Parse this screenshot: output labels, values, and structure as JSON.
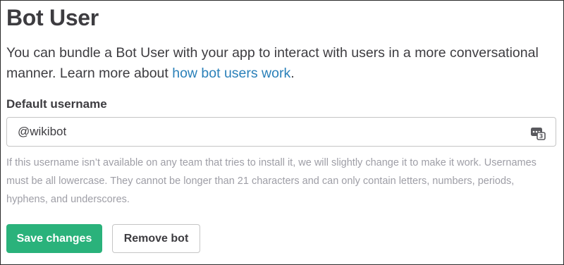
{
  "section": {
    "title": "Bot User",
    "description_before_link": "You can bundle a Bot User with your app to interact with users in a more conversational manner. Learn more about ",
    "description_link": "how bot users work",
    "description_after_link": "."
  },
  "username_field": {
    "label": "Default username",
    "value": "@wikibot",
    "icon": "password-manager-icon",
    "help_text": "If this username isn’t available on any team that tries to install it, we will slightly change it to make it work. Usernames must be all lowercase. They cannot be longer than 21 characters and can only contain letters, numbers, periods, hyphens, and underscores."
  },
  "actions": {
    "save_label": "Save changes",
    "remove_label": "Remove bot"
  },
  "colors": {
    "primary_button": "#2ab27b",
    "link": "#2a80b9",
    "text": "#3d3c40",
    "help_text": "#9e9ea6"
  }
}
